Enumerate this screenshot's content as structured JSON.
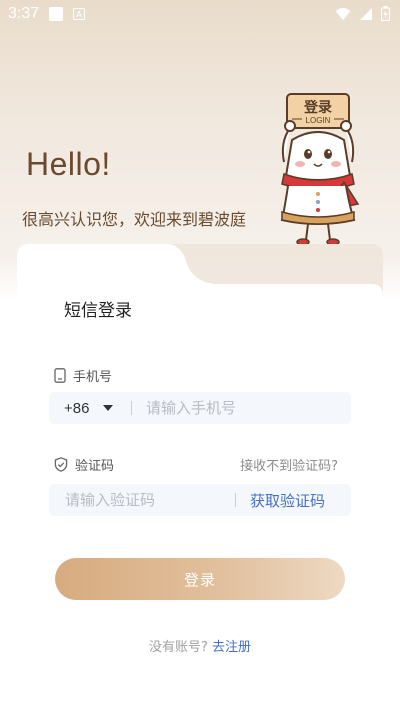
{
  "status_bar": {
    "time": "3:37",
    "icons": [
      "notification-square-icon",
      "a-icon",
      "wifi-icon",
      "signal-icon",
      "battery-icon"
    ]
  },
  "header": {
    "greeting": "Hello!",
    "welcome_text": "很高兴认识您，欢迎来到碧波庭"
  },
  "mascot": {
    "sign_text": "登录",
    "sign_subtext": "LOGIN"
  },
  "login_card": {
    "tab_title": "短信登录",
    "phone": {
      "label": "手机号",
      "country_code": "+86",
      "placeholder": "请输入手机号",
      "value": ""
    },
    "code": {
      "label": "验证码",
      "help_text": "接收不到验证码?",
      "placeholder": "请输入验证码",
      "value": "",
      "get_code_label": "获取验证码"
    },
    "login_button": "登录",
    "register": {
      "prompt": "没有账号?",
      "link": "去注册"
    }
  },
  "colors": {
    "brand_brown": "#6a4a2d",
    "link_blue": "#4670c8",
    "button_gradient_start": "#d7ab7f",
    "button_gradient_end": "#eed9c3",
    "input_bg": "#f4f7fb"
  }
}
